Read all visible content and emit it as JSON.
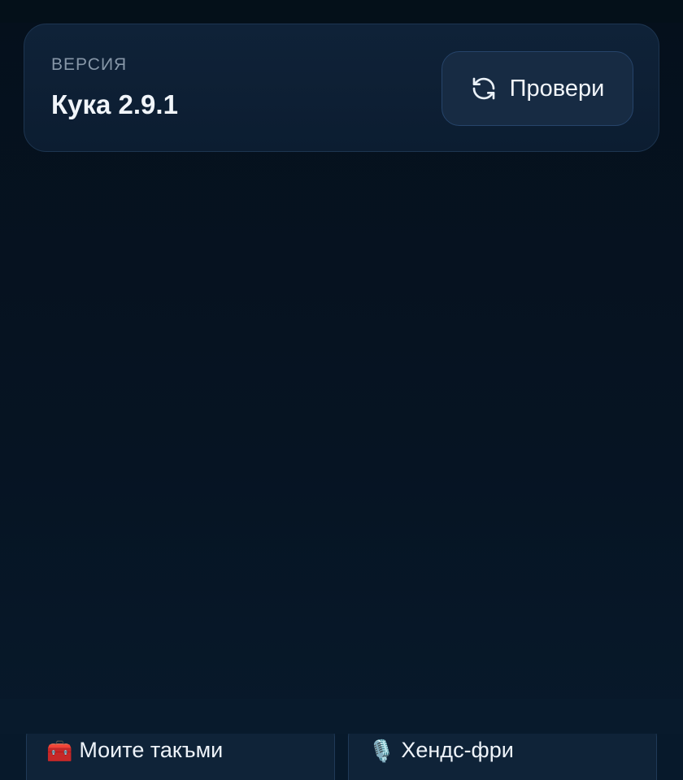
{
  "version_card": {
    "caption": "ВЕРСИЯ",
    "value": "Кука 2.9.1",
    "check_button": {
      "label": "Провери",
      "icon": "refresh-icon"
    }
  },
  "bottom_chips": [
    {
      "emoji": "🧰",
      "icon": "toolbox-icon",
      "label": "Моите такъми"
    },
    {
      "emoji": "🎙️",
      "icon": "microphone-icon",
      "label": "Хендс-фри"
    }
  ]
}
